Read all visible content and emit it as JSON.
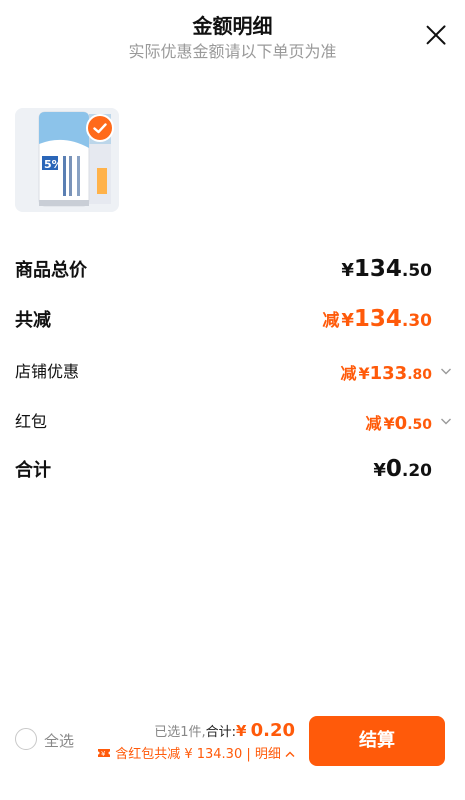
{
  "header": {
    "title": "金额明细",
    "subtitle": "实际优惠金额请以下单页为准"
  },
  "product": {
    "thumbnail": "toothpaste-product-image",
    "selected": true
  },
  "rows": {
    "total": {
      "label": "商品总价",
      "yen": "¥",
      "int": "134",
      "dec": ".50"
    },
    "discount": {
      "label": "共减",
      "prefix": "减",
      "yen": "¥",
      "int": "134",
      "dec": ".30"
    },
    "store": {
      "label": "店铺优惠",
      "prefix": "减",
      "yen": "¥",
      "int": "133",
      "dec": ".80"
    },
    "redpacket": {
      "label": "红包",
      "prefix": "减",
      "yen": "¥",
      "int": "0",
      "dec": ".50"
    },
    "subtotal": {
      "label": "合计",
      "yen": "¥",
      "int": "0",
      "dec": ".20"
    }
  },
  "footer": {
    "select_all": "全选",
    "selected_count": "已选1件,",
    "sum_label": "合计:",
    "sum_yen": "¥",
    "sum_amount": "0.20",
    "detail_line": "含红包共减 ¥ 134.30 | 明细",
    "pay_button": "结算"
  },
  "colors": {
    "accent": "#ff5a0a",
    "text": "#111111",
    "muted": "#9a9a9a"
  }
}
